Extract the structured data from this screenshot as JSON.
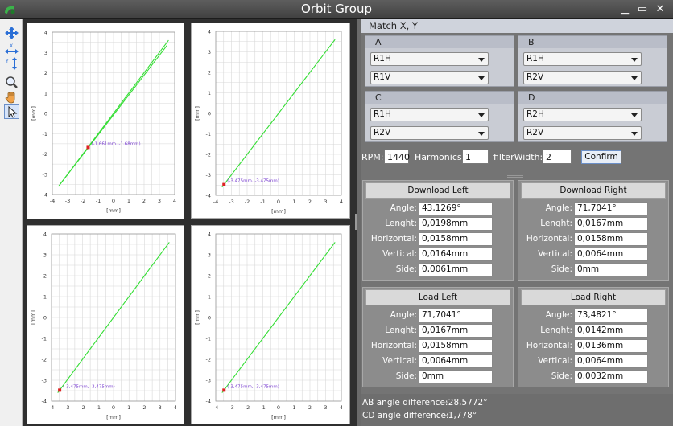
{
  "window": {
    "title": "Orbit Group",
    "icon": "app-logo-icon",
    "controls": [
      "minimize-icon",
      "maximize-icon",
      "close-icon"
    ]
  },
  "toolbar": {
    "tools": [
      "pan-all-icon",
      "fit-x-icon",
      "fit-y-icon",
      "zoom-icon",
      "hand-icon",
      "pointer-icon"
    ]
  },
  "plots": [
    {
      "id": "plot-1",
      "xlabel": "[mm]",
      "ylabel": "[mm]",
      "xticks": [
        "-4",
        "-3",
        "-2",
        "-1",
        "0",
        "1",
        "2",
        "3",
        "4"
      ],
      "yticks": [
        "4",
        "3",
        "2",
        "1",
        "0",
        "-1",
        "-2",
        "-3",
        "-4"
      ],
      "annotation": "(-1,661mm, -1,68mm)",
      "marker": [
        -1.66,
        -1.68
      ],
      "line": [
        [
          -3.6,
          -3.6
        ],
        [
          3.6,
          3.6
        ]
      ],
      "line2": [
        [
          -3.5,
          -3.5
        ],
        [
          3.5,
          3.35
        ]
      ]
    },
    {
      "id": "plot-2",
      "xlabel": "[mm]",
      "ylabel": "[mm]",
      "xticks": [
        "-4",
        "-3",
        "-2",
        "-1",
        "0",
        "1",
        "2",
        "3",
        "4"
      ],
      "yticks": [
        "4",
        "3",
        "2",
        "1",
        "0",
        "-1",
        "-2",
        "-3",
        "-4"
      ],
      "annotation": "(-3,475mm, -3,475mm)",
      "marker": [
        -3.475,
        -3.475
      ],
      "line": [
        [
          -3.6,
          -3.6
        ],
        [
          3.6,
          3.6
        ]
      ]
    },
    {
      "id": "plot-3",
      "xlabel": "[mm]",
      "ylabel": "[mm]",
      "xticks": [
        "-4",
        "-3",
        "-2",
        "-1",
        "0",
        "1",
        "2",
        "3",
        "4"
      ],
      "yticks": [
        "4",
        "3",
        "2",
        "1",
        "0",
        "-1",
        "-2",
        "-3",
        "-4"
      ],
      "annotation": "(-3,475mm, -3,475mm)",
      "marker": [
        -3.475,
        -3.475
      ],
      "line": [
        [
          -3.6,
          -3.6
        ],
        [
          3.6,
          3.6
        ]
      ]
    },
    {
      "id": "plot-4",
      "xlabel": "[mm]",
      "ylabel": "[mm]",
      "xticks": [
        "-4",
        "-3",
        "-2",
        "-1",
        "0",
        "1",
        "2",
        "3",
        "4"
      ],
      "yticks": [
        "4",
        "3",
        "2",
        "1",
        "0",
        "-1",
        "-2",
        "-3",
        "-4"
      ],
      "annotation": "(-3,475mm, -3,475mm)",
      "marker": [
        -3.475,
        -3.475
      ],
      "line": [
        [
          -3.6,
          -3.6
        ],
        [
          3.6,
          3.6
        ]
      ]
    }
  ],
  "match": {
    "header": "Match X, Y",
    "groups": [
      {
        "label": "A",
        "sel1": "R1H",
        "sel2": "R1V"
      },
      {
        "label": "B",
        "sel1": "R1H",
        "sel2": "R2V"
      },
      {
        "label": "C",
        "sel1": "R1H",
        "sel2": "R2V"
      },
      {
        "label": "D",
        "sel1": "R2H",
        "sel2": "R2V"
      }
    ]
  },
  "params": {
    "rpm_label": "RPM:",
    "rpm": "1440",
    "harmonics_label": "Harmonics:",
    "harmonics": "1",
    "filter_label": "filterWidth:",
    "filter": "2",
    "confirm": "Confirm"
  },
  "results": {
    "row_labels": [
      "Angle:",
      "Lenght:",
      "Horizontal:",
      "Vertical:",
      "Side:"
    ],
    "download_left": {
      "title": "Download Left",
      "values": [
        "43,1269°",
        "0,0198mm",
        "0,0158mm",
        "0,0164mm",
        "0,0061mm"
      ]
    },
    "download_right": {
      "title": "Download Right",
      "values": [
        "71,7041°",
        "0,0167mm",
        "0,0158mm",
        "0,0064mm",
        "0mm"
      ]
    },
    "load_left": {
      "title": "Load Left",
      "values": [
        "71,7041°",
        "0,0167mm",
        "0,0158mm",
        "0,0064mm",
        "0mm"
      ]
    },
    "load_right": {
      "title": "Load Right",
      "values": [
        "73,4821°",
        "0,0142mm",
        "0,0136mm",
        "0,0064mm",
        "0,0032mm"
      ]
    }
  },
  "differences": {
    "ab_label": "AB angle difference:",
    "ab_value": "-28,5772°",
    "cd_label": "CD angle difference:",
    "cd_value": "-1,778°"
  },
  "colors": {
    "orbit_line": "#33dd33",
    "marker": "#dd2222",
    "annotation": "#7a3fd0",
    "grid": "#d8d8d8"
  }
}
